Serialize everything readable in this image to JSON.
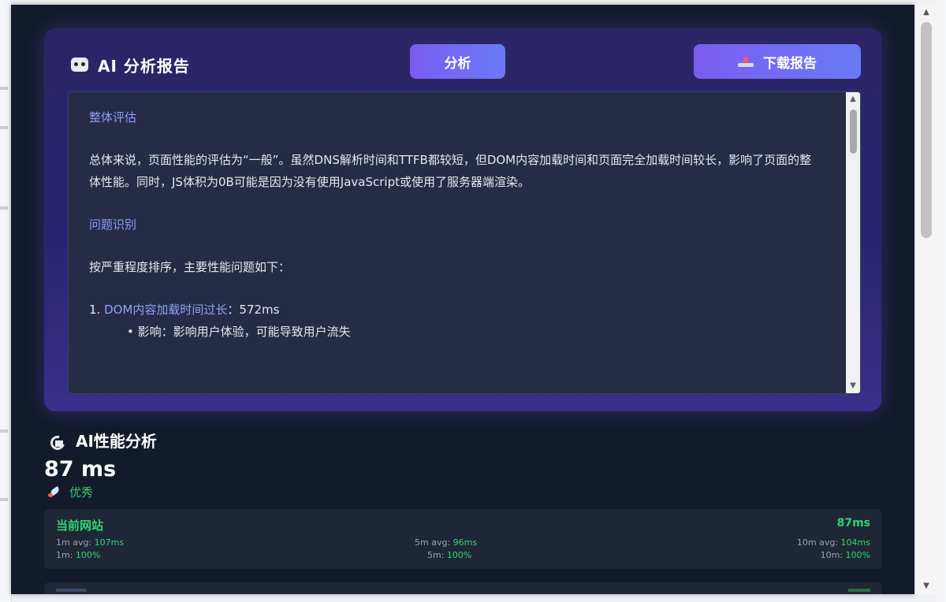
{
  "ai_report": {
    "title": "AI 分析报告",
    "analyze_button": "分析",
    "download_button": "下载报告",
    "content": {
      "section1_title": "整体评估",
      "section1_paragraph": "总体来说，页面性能的评估为“一般”。虽然DNS解析时间和TTFB都较短，但DOM内容加载时间和页面完全加载时间较长，影响了页面的整体性能。同时，JS体积为0B可能是因为没有使用JavaScript或使用了服务器端渲染。",
      "section2_title": "问题识别",
      "section2_intro": "按严重程度排序，主要性能问题如下：",
      "issue1_number": "1.",
      "issue1_label": "DOM内容加载时间过长",
      "issue1_value": "：572ms",
      "issue1_impact": "• 影响：影响用户体验，可能导致用户流失"
    }
  },
  "performance": {
    "title": "AI性能分析",
    "value": "87 ms",
    "rating": "优秀",
    "site_card": {
      "name": "当前网站",
      "latency": "87ms",
      "avg_1m_label": "1m avg: ",
      "avg_1m_value": "107ms",
      "avg_5m_label": "5m avg: ",
      "avg_5m_value": "96ms",
      "avg_10m_label": "10m avg: ",
      "avg_10m_value": "104ms",
      "ok_1m_label": "1m: ",
      "ok_1m_value": "100%",
      "ok_5m_label": "5m: ",
      "ok_5m_value": "100%",
      "ok_10m_label": "10m: ",
      "ok_10m_value": "100%"
    }
  },
  "colors": {
    "panel_bg": "#131a2b",
    "card_purple": "#2b2566",
    "accent_button": "#7b5cf0",
    "good_green": "#33d470",
    "link_blue": "#8a9bff"
  },
  "icons": {
    "report_title": "robot-icon",
    "download": "download-icon",
    "perf_title": "satellite-icon",
    "rating": "rocket-icon"
  }
}
